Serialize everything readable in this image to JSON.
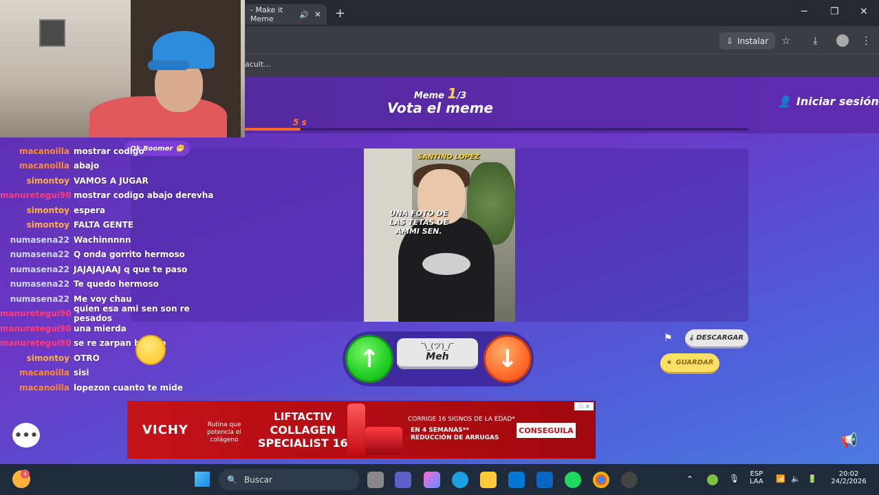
{
  "browser": {
    "tab_title": "- Make it Meme",
    "tab_close": "✕",
    "new_tab": "+",
    "install_label": "Instalar",
    "bookmark_label": "acult...",
    "win_min": "─",
    "win_max": "❐",
    "win_close": "✕"
  },
  "game": {
    "meme_label": "Meme",
    "meme_current": "1",
    "meme_total": "/3",
    "title": "Vota el meme",
    "login": "Iniciar sesión",
    "timer": "5 s",
    "progress": 0.11,
    "badge": "Ok Boomer",
    "meme_caption_name": "SANTINO LOPEZ",
    "meme_caption": "UNA FOTO DE LAS TETAS DE AMMI SEN.",
    "shrug": "¯\\_(ツ)_/¯",
    "meh": "Meh",
    "download": "DESCARGAR",
    "save": "GUARDAR"
  },
  "chat": [
    {
      "user": "macanoilla",
      "msg": "mostrar codigo",
      "color": "#ff8a2b"
    },
    {
      "user": "macanoilla",
      "msg": "abajo",
      "color": "#ff8a2b"
    },
    {
      "user": "simontoy",
      "msg": "VAMOS A JUGAR",
      "color": "#ffb13b"
    },
    {
      "user": "manuretegui90",
      "msg": "mostrar codigo abajo derevha",
      "color": "#ff3b7a"
    },
    {
      "user": "simontoy",
      "msg": "espera",
      "color": "#ffb13b"
    },
    {
      "user": "simontoy",
      "msg": "FALTA GENTE",
      "color": "#ffb13b"
    },
    {
      "user": "numasena22",
      "msg": "Wachinnnnn",
      "color": "#cfd6ff"
    },
    {
      "user": "numasena22",
      "msg": "Q onda gorrito hermoso",
      "color": "#cfd6ff"
    },
    {
      "user": "numasena22",
      "msg": "JAJAJAJAAJ q que te paso",
      "color": "#cfd6ff"
    },
    {
      "user": "numasena22",
      "msg": "Te quedo hermoso",
      "color": "#cfd6ff"
    },
    {
      "user": "numasena22",
      "msg": "Me voy chau",
      "color": "#cfd6ff"
    },
    {
      "user": "manuretegui90",
      "msg": "quien esa ami sen son re pesados",
      "color": "#ff3b7a"
    },
    {
      "user": "manuretegui90",
      "msg": "una mierda",
      "color": "#ff3b7a"
    },
    {
      "user": "manuretegui90",
      "msg": "se re zarpan boludo",
      "color": "#ff3b7a"
    },
    {
      "user": "simontoy",
      "msg": "OTRO",
      "color": "#ffb13b"
    },
    {
      "user": "macanoilla",
      "msg": "sisi",
      "color": "#ff8a2b"
    },
    {
      "user": "macanoilla",
      "msg": "lopezon cuanto te mide",
      "color": "#ff8a2b"
    }
  ],
  "ad": {
    "brand": "VICHY",
    "tagline": "Rutina que potencia el colágeno",
    "product_l1": "LIFTACTIV",
    "product_l2": "COLLAGEN",
    "product_l3": "SPECIALIST 16",
    "corrige": "CORRIGE 16 SIGNOS DE LA EDAD*",
    "weeks": "EN 4 SEMANAS** REDUCCIÓN DE ARRUGAS",
    "cta": "CONSEGUILA"
  },
  "taskbar": {
    "search": "Buscar",
    "lang1": "ESP",
    "lang2": "LAA",
    "time": "20:02",
    "date": "24/2/2026",
    "notif_count": "4"
  },
  "icons": [
    "download-icon",
    "star-icon",
    "profile-icon",
    "menu-icon",
    "user-icon",
    "flag-icon",
    "chat-icon",
    "megaphone-icon",
    "windows-icon",
    "search-icon"
  ]
}
